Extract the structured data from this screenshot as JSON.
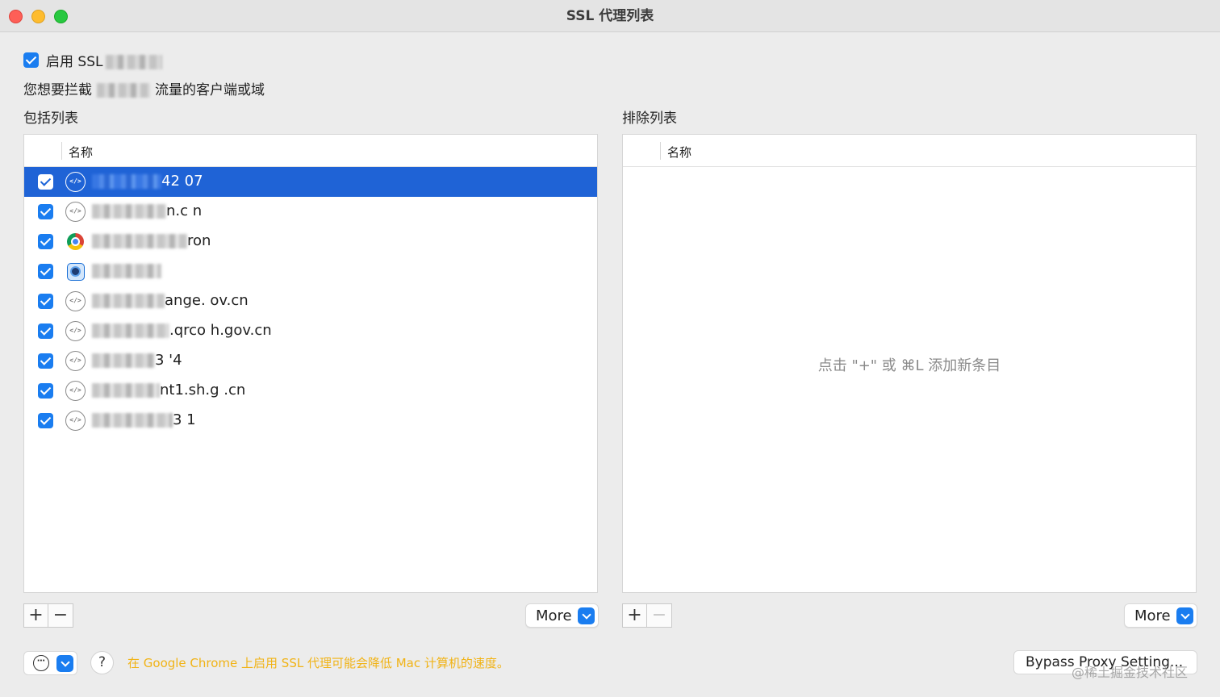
{
  "window": {
    "title": "SSL 代理列表"
  },
  "enable": {
    "label": "启用 SSL",
    "checked": true
  },
  "description": "您想要拦截",
  "description_suffix": "流量的客户端或域",
  "include": {
    "label": "包括列表",
    "column_name": "名称",
    "rows": [
      {
        "host_suffix": "42 07",
        "icon": "code-icon",
        "checked": true,
        "selected": true
      },
      {
        "host_suffix": "n.c n",
        "icon": "code-icon",
        "checked": true,
        "selected": false
      },
      {
        "host_suffix": "ron",
        "icon": "chrome-icon",
        "checked": true,
        "selected": false
      },
      {
        "host_suffix": "",
        "icon": "app-icon",
        "checked": true,
        "selected": false
      },
      {
        "host_suffix": "ange.   ov.cn",
        "icon": "code-icon",
        "checked": true,
        "selected": false
      },
      {
        "host_suffix": ".qrco   h.gov.cn",
        "icon": "code-icon",
        "checked": true,
        "selected": false
      },
      {
        "host_suffix": "3  '4",
        "icon": "code-icon",
        "checked": true,
        "selected": false
      },
      {
        "host_suffix": "nt1.sh.g  .cn",
        "icon": "code-icon",
        "checked": true,
        "selected": false
      },
      {
        "host_suffix": "3  1",
        "icon": "code-icon",
        "checked": true,
        "selected": false
      }
    ],
    "add_label": "+",
    "remove_label": "−",
    "more_label": "More"
  },
  "exclude": {
    "label": "排除列表",
    "column_name": "名称",
    "empty_hint": "点击 \"+\" 或 ⌘L 添加新条目",
    "add_label": "+",
    "remove_label": "−",
    "more_label": "More"
  },
  "footer": {
    "action_icon": "⋯",
    "help_label": "?",
    "warning": "在 Google Chrome 上启用 SSL 代理可能会降低 Mac 计算机的速度。",
    "bypass_label": "Bypass Proxy Setting...",
    "watermark": "@稀土掘金技术社区"
  },
  "colors": {
    "accent": "#1a7df0",
    "selection": "#1f63d6",
    "warning": "#f1b316"
  }
}
